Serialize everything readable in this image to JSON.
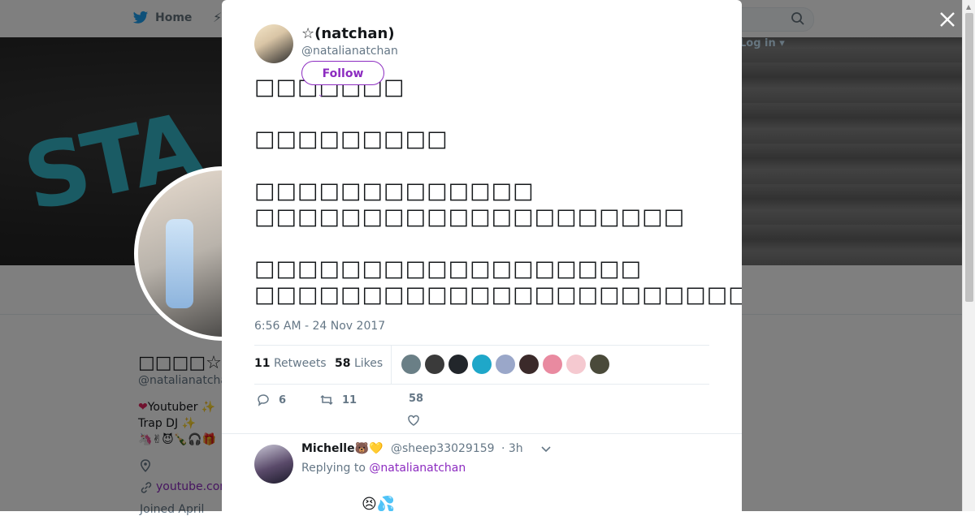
{
  "nav": {
    "home_label": "Home",
    "login_label": "Log in"
  },
  "profile": {
    "name": "□□□□☆□□□",
    "handle": "@natalianatcha",
    "bio_line1": "Youtuber ✨",
    "bio_line2": "Trap DJ ✨",
    "bio_line3": "🦄✌😈🍾🎧🎁",
    "link": "youtube.com",
    "joined": "Joined April"
  },
  "tweet": {
    "author_name": "☆(natchan)",
    "author_handle": "@natalianatchan",
    "follow_label": "Follow",
    "text": "□□□□□□□\n\n□□□□□□□□□\n\n□□□□□□□□□□□□□\n□□□□□□□□□□□□□□□□□□□□\n\n□□□□□□□□□□□□□□□□□□\n□□□□□□□□□□□□□□□□□□□□□□□□□□□□□□□□□□□□□□□□□",
    "timestamp": "6:56 AM - 24 Nov 2017",
    "retweets_count": "11",
    "retweets_label": "Retweets",
    "likes_count": "58",
    "likes_label": "Likes",
    "reply_count": "6",
    "retweet_action_count": "11",
    "like_action_count": "58"
  },
  "likers_colors": [
    "#6a7f86",
    "#3a3a3a",
    "#22262b",
    "#1fa7c9",
    "#9aa7c9",
    "#3b2a2a",
    "#e98aa0",
    "#f5c9d0",
    "#4a4a3a"
  ],
  "reply": {
    "name": "Michelle🐻💛",
    "handle": "@sheep33029159",
    "time": "· 3h",
    "replying_prefix": "Replying to",
    "replying_handle": "@natalianatchan",
    "emoji": "😣💦"
  },
  "colors": {
    "accent": "#8c2bc0",
    "muted": "#657786",
    "text": "#14171a"
  }
}
